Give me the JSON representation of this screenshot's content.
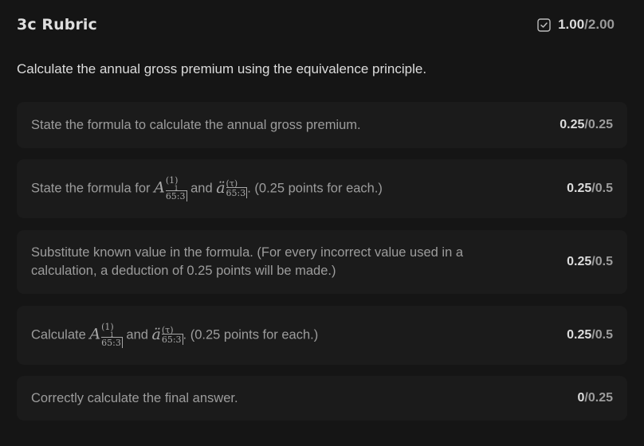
{
  "header": {
    "title": "3c Rubric",
    "score_earned": "1.00",
    "score_separator": "/",
    "score_total": "2.00"
  },
  "question": "Calculate the annual gross premium using the equivalence principle.",
  "criteria": [
    {
      "text": "State the formula to calculate the annual gross premium.",
      "earned": "0.25",
      "total": "0.25"
    },
    {
      "text_before": "State the formula for ",
      "text_mid": " and ",
      "text_after": ". (0.25 points for each.)",
      "earned": "0.25",
      "total": "0.5"
    },
    {
      "text": "Substitute known value in the formula. (For every incorrect value used in a calculation, a deduction of 0.25 points will be made.)",
      "earned": "0.25",
      "total": "0.5"
    },
    {
      "text_before": "Calculate ",
      "text_mid": " and ",
      "text_after": ". (0.25 points for each.)",
      "earned": "0.25",
      "total": "0.5"
    },
    {
      "text": "Correctly calculate the final answer.",
      "earned": "0",
      "total": "0.25"
    }
  ],
  "math": {
    "A_symbol": "A",
    "A_superscript": "(1)",
    "A_tiny_one": "1",
    "A_subscript": "65:3",
    "a_symbol": "ä",
    "a_superscript": "(τ)",
    "a_subscript": "65:3"
  },
  "icons": {
    "score_icon": "checkbox-check-icon"
  }
}
